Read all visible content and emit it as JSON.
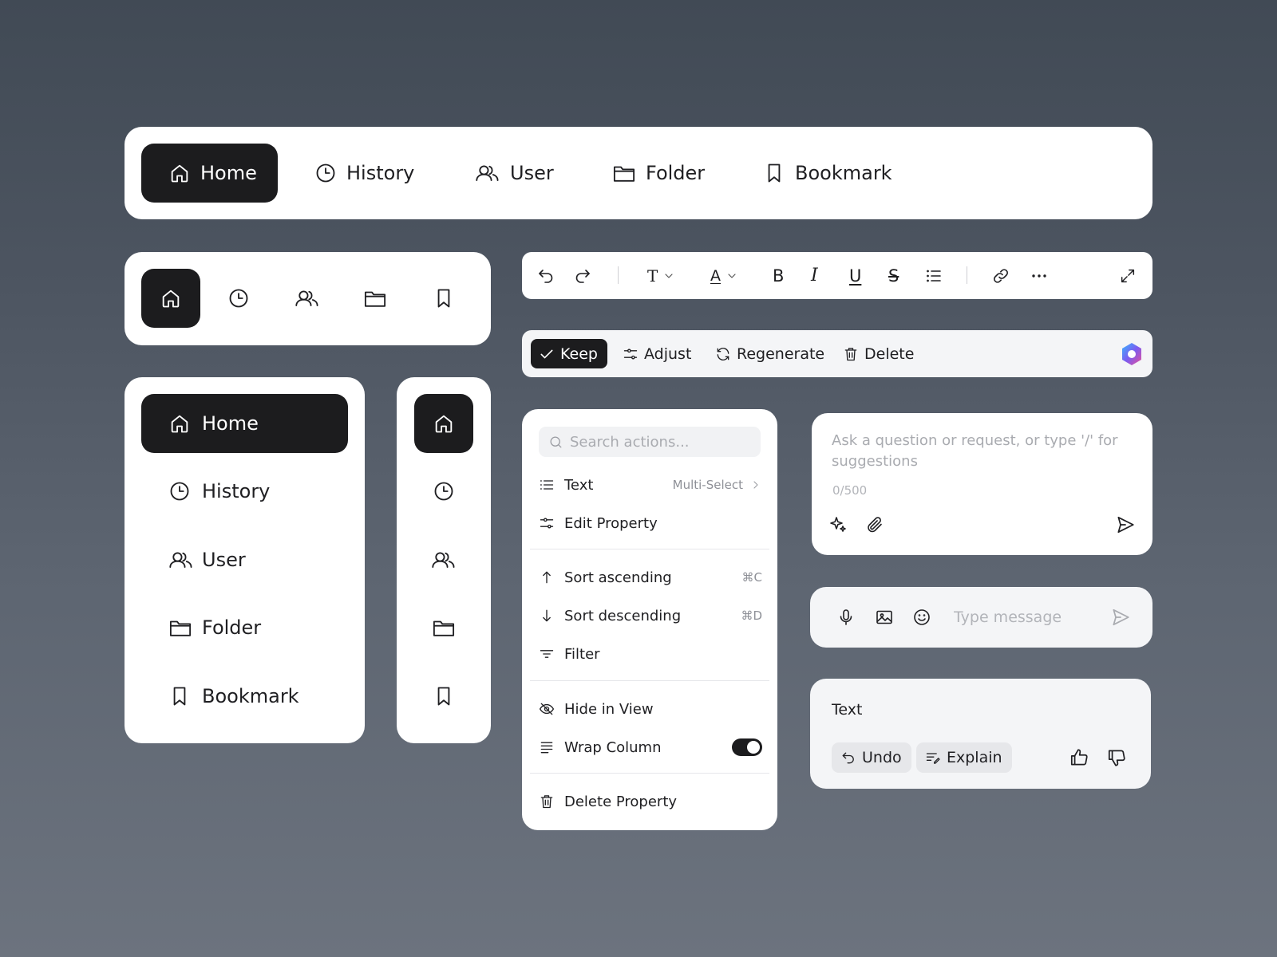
{
  "nav": {
    "items": [
      {
        "label": "Home",
        "icon": "home-icon",
        "active": true
      },
      {
        "label": "History",
        "icon": "clock-icon"
      },
      {
        "label": "User",
        "icon": "users-icon"
      },
      {
        "label": "Folder",
        "icon": "folder-icon"
      },
      {
        "label": "Bookmark",
        "icon": "bookmark-icon"
      }
    ]
  },
  "toolbar": {
    "tools": [
      "undo-icon",
      "redo-icon",
      "text-style-icon",
      "font-color-icon",
      "bold-icon",
      "italic-icon",
      "underline-icon",
      "strikethrough-icon",
      "list-icon",
      "link-icon",
      "more-icon",
      "expand-icon"
    ],
    "text_style_label": "T",
    "font_color_label": "A",
    "bold_label": "B",
    "italic_label": "I",
    "underline_label": "U",
    "strike_label": "S"
  },
  "ai_bar": {
    "keep": "Keep",
    "adjust": "Adjust",
    "regenerate": "Regenerate",
    "delete": "Delete"
  },
  "menu": {
    "search_placeholder": "Search actions...",
    "text": "Text",
    "text_meta": "Multi-Select",
    "edit_property": "Edit Property",
    "sort_ascending": "Sort ascending",
    "sort_ascending_shortcut": "⌘C",
    "sort_descending": "Sort descending",
    "sort_descending_shortcut": "⌘D",
    "filter": "Filter",
    "hide_in_view": "Hide in View",
    "wrap_column": "Wrap Column",
    "wrap_column_on": true,
    "delete_property": "Delete Property"
  },
  "prompt": {
    "placeholder": "Ask a question or request, or type '/' for suggestions",
    "count": "0/500"
  },
  "message": {
    "placeholder": "Type message"
  },
  "response": {
    "text": "Text",
    "undo": "Undo",
    "explain": "Explain"
  },
  "colors": {
    "active_bg": "#1c1c1e",
    "card_bg": "#ffffff",
    "muted_bg": "#f4f5f7",
    "placeholder": "#a9abb0"
  }
}
